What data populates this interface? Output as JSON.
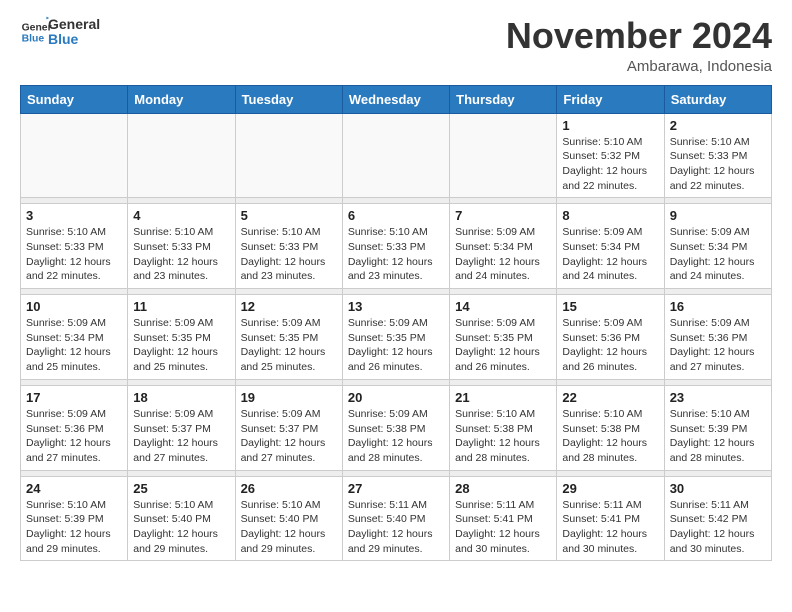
{
  "logo": {
    "line1": "General",
    "line2": "Blue"
  },
  "title": "November 2024",
  "subtitle": "Ambarawa, Indonesia",
  "days_of_week": [
    "Sunday",
    "Monday",
    "Tuesday",
    "Wednesday",
    "Thursday",
    "Friday",
    "Saturday"
  ],
  "weeks": [
    [
      {
        "day": "",
        "info": ""
      },
      {
        "day": "",
        "info": ""
      },
      {
        "day": "",
        "info": ""
      },
      {
        "day": "",
        "info": ""
      },
      {
        "day": "",
        "info": ""
      },
      {
        "day": "1",
        "info": "Sunrise: 5:10 AM\nSunset: 5:32 PM\nDaylight: 12 hours and 22 minutes."
      },
      {
        "day": "2",
        "info": "Sunrise: 5:10 AM\nSunset: 5:33 PM\nDaylight: 12 hours and 22 minutes."
      }
    ],
    [
      {
        "day": "3",
        "info": "Sunrise: 5:10 AM\nSunset: 5:33 PM\nDaylight: 12 hours and 22 minutes."
      },
      {
        "day": "4",
        "info": "Sunrise: 5:10 AM\nSunset: 5:33 PM\nDaylight: 12 hours and 23 minutes."
      },
      {
        "day": "5",
        "info": "Sunrise: 5:10 AM\nSunset: 5:33 PM\nDaylight: 12 hours and 23 minutes."
      },
      {
        "day": "6",
        "info": "Sunrise: 5:10 AM\nSunset: 5:33 PM\nDaylight: 12 hours and 23 minutes."
      },
      {
        "day": "7",
        "info": "Sunrise: 5:09 AM\nSunset: 5:34 PM\nDaylight: 12 hours and 24 minutes."
      },
      {
        "day": "8",
        "info": "Sunrise: 5:09 AM\nSunset: 5:34 PM\nDaylight: 12 hours and 24 minutes."
      },
      {
        "day": "9",
        "info": "Sunrise: 5:09 AM\nSunset: 5:34 PM\nDaylight: 12 hours and 24 minutes."
      }
    ],
    [
      {
        "day": "10",
        "info": "Sunrise: 5:09 AM\nSunset: 5:34 PM\nDaylight: 12 hours and 25 minutes."
      },
      {
        "day": "11",
        "info": "Sunrise: 5:09 AM\nSunset: 5:35 PM\nDaylight: 12 hours and 25 minutes."
      },
      {
        "day": "12",
        "info": "Sunrise: 5:09 AM\nSunset: 5:35 PM\nDaylight: 12 hours and 25 minutes."
      },
      {
        "day": "13",
        "info": "Sunrise: 5:09 AM\nSunset: 5:35 PM\nDaylight: 12 hours and 26 minutes."
      },
      {
        "day": "14",
        "info": "Sunrise: 5:09 AM\nSunset: 5:35 PM\nDaylight: 12 hours and 26 minutes."
      },
      {
        "day": "15",
        "info": "Sunrise: 5:09 AM\nSunset: 5:36 PM\nDaylight: 12 hours and 26 minutes."
      },
      {
        "day": "16",
        "info": "Sunrise: 5:09 AM\nSunset: 5:36 PM\nDaylight: 12 hours and 27 minutes."
      }
    ],
    [
      {
        "day": "17",
        "info": "Sunrise: 5:09 AM\nSunset: 5:36 PM\nDaylight: 12 hours and 27 minutes."
      },
      {
        "day": "18",
        "info": "Sunrise: 5:09 AM\nSunset: 5:37 PM\nDaylight: 12 hours and 27 minutes."
      },
      {
        "day": "19",
        "info": "Sunrise: 5:09 AM\nSunset: 5:37 PM\nDaylight: 12 hours and 27 minutes."
      },
      {
        "day": "20",
        "info": "Sunrise: 5:09 AM\nSunset: 5:38 PM\nDaylight: 12 hours and 28 minutes."
      },
      {
        "day": "21",
        "info": "Sunrise: 5:10 AM\nSunset: 5:38 PM\nDaylight: 12 hours and 28 minutes."
      },
      {
        "day": "22",
        "info": "Sunrise: 5:10 AM\nSunset: 5:38 PM\nDaylight: 12 hours and 28 minutes."
      },
      {
        "day": "23",
        "info": "Sunrise: 5:10 AM\nSunset: 5:39 PM\nDaylight: 12 hours and 28 minutes."
      }
    ],
    [
      {
        "day": "24",
        "info": "Sunrise: 5:10 AM\nSunset: 5:39 PM\nDaylight: 12 hours and 29 minutes."
      },
      {
        "day": "25",
        "info": "Sunrise: 5:10 AM\nSunset: 5:40 PM\nDaylight: 12 hours and 29 minutes."
      },
      {
        "day": "26",
        "info": "Sunrise: 5:10 AM\nSunset: 5:40 PM\nDaylight: 12 hours and 29 minutes."
      },
      {
        "day": "27",
        "info": "Sunrise: 5:11 AM\nSunset: 5:40 PM\nDaylight: 12 hours and 29 minutes."
      },
      {
        "day": "28",
        "info": "Sunrise: 5:11 AM\nSunset: 5:41 PM\nDaylight: 12 hours and 30 minutes."
      },
      {
        "day": "29",
        "info": "Sunrise: 5:11 AM\nSunset: 5:41 PM\nDaylight: 12 hours and 30 minutes."
      },
      {
        "day": "30",
        "info": "Sunrise: 5:11 AM\nSunset: 5:42 PM\nDaylight: 12 hours and 30 minutes."
      }
    ]
  ]
}
